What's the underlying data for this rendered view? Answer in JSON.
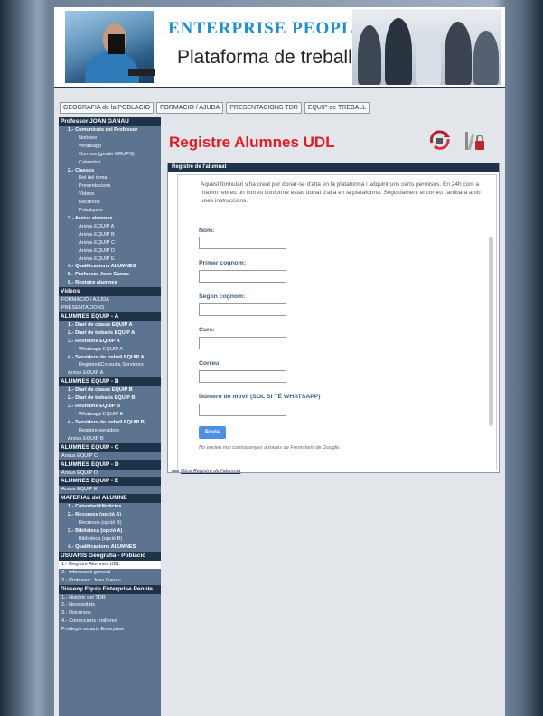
{
  "header": {
    "title": "ENTERPRISE  PEOPLE",
    "subtitle": "Plataforma de treball"
  },
  "tabs": [
    "GEOGRAFIA de la POBLACIÓ",
    "FORMACIÓ / AJUDA",
    "PRESENTACIONS TDR",
    "EQUIP de TREBALL"
  ],
  "sidebar": {
    "items": [
      {
        "text": "Professor JOAN GANAU",
        "kind": "head"
      },
      {
        "text": "1.- Comunicats del Professor",
        "kind": "l1"
      },
      {
        "text": "Notícies",
        "kind": "l2"
      },
      {
        "text": "Whatsapp",
        "kind": "l2"
      },
      {
        "text": "Correus (gestió GRUPS)",
        "kind": "l2"
      },
      {
        "text": "Calendari",
        "kind": "l2"
      },
      {
        "text": "2.- Classes",
        "kind": "l1"
      },
      {
        "text": "Rol del tema",
        "kind": "l2"
      },
      {
        "text": "Presentacions",
        "kind": "l2"
      },
      {
        "text": "Vídeos",
        "kind": "l2"
      },
      {
        "text": "Recursos",
        "kind": "l2"
      },
      {
        "text": "Pràctiques",
        "kind": "l2"
      },
      {
        "text": "3.- Arxius alumnes",
        "kind": "l1"
      },
      {
        "text": "Arxius EQUIP A",
        "kind": "l2"
      },
      {
        "text": "Arxius EQUIP B",
        "kind": "l2"
      },
      {
        "text": "Arxius EQUIP C",
        "kind": "l2"
      },
      {
        "text": "Arxius EQUIP D",
        "kind": "l2"
      },
      {
        "text": "Arxius EQUIP E",
        "kind": "l2"
      },
      {
        "text": "4.- Qualificacions ALUMNES",
        "kind": "l1"
      },
      {
        "text": "5.- Professor Joan Ganau",
        "kind": "l1"
      },
      {
        "text": "6.- Registre alumnes",
        "kind": "l1"
      },
      {
        "text": "Vídeos",
        "kind": "head"
      },
      {
        "text": "FORMACIÓ / AJUDA",
        "kind": "l0"
      },
      {
        "text": "PRESENTACIONS",
        "kind": "l0"
      },
      {
        "text": "ALUMNES EQUIP - A",
        "kind": "head"
      },
      {
        "text": "1.- Diari de classe EQUIP A",
        "kind": "l1"
      },
      {
        "text": "2.- Diari de treballs EQUIP A",
        "kind": "l1"
      },
      {
        "text": "3.- Reunions EQUIP A",
        "kind": "l1"
      },
      {
        "text": "Whatsapp EQUIP A",
        "kind": "l2"
      },
      {
        "text": "4.- Servidors de treball EQUIP A",
        "kind": "l1"
      },
      {
        "text": "Registre&Consulta Servidors",
        "kind": "l2"
      },
      {
        "text": "Arxius EQUIP A",
        "kind": "l0b"
      },
      {
        "text": "ALUMNES EQUIP - B",
        "kind": "head"
      },
      {
        "text": "1.- Diari de classe EQUIP B",
        "kind": "l1"
      },
      {
        "text": "2.- Diari de treballs EQUIP B",
        "kind": "l1"
      },
      {
        "text": "3.- Reunions EQUIP B",
        "kind": "l1"
      },
      {
        "text": "Whatsapp EQUIP B",
        "kind": "l2"
      },
      {
        "text": "4.- Servidors de treball EQUIP B",
        "kind": "l1"
      },
      {
        "text": "Registre servidors",
        "kind": "l2"
      },
      {
        "text": "Arxius EQUIP B",
        "kind": "l0b"
      },
      {
        "text": "ALUMNES EQUIP - C",
        "kind": "head"
      },
      {
        "text": "Arxius EQUIP C",
        "kind": "l0"
      },
      {
        "text": "ALUMNES EQUIP - D",
        "kind": "head"
      },
      {
        "text": "Arxius EQUIP D",
        "kind": "l0"
      },
      {
        "text": "ALUMNES EQUIP - E",
        "kind": "head"
      },
      {
        "text": "Arxius EQUIP E",
        "kind": "l0"
      },
      {
        "text": "MATERIAL del ALUMNE",
        "kind": "head"
      },
      {
        "text": "1.- Calendari&Notícies",
        "kind": "l1"
      },
      {
        "text": "2.- Recursos (opció A)",
        "kind": "l1"
      },
      {
        "text": "Recursos (opció B)",
        "kind": "l2"
      },
      {
        "text": "3.- Biblioteca (opció A)",
        "kind": "l1"
      },
      {
        "text": "Biblioteca (opció B)",
        "kind": "l2"
      },
      {
        "text": "4.- Qualificacions ALUMNES",
        "kind": "l1"
      },
      {
        "text": "USUARIS Geografia - Població",
        "kind": "head"
      },
      {
        "text": "1.- Registre Alumnes UDL",
        "kind": "active"
      },
      {
        "text": "2.- Informació general",
        "kind": "l0"
      },
      {
        "text": "3.- Professor: Joan Ganau",
        "kind": "l0"
      },
      {
        "text": "Disseny Equip Enterprise People",
        "kind": "head"
      },
      {
        "text": "1.- Històric del TDR",
        "kind": "l0"
      },
      {
        "text": "2.- Necessitats",
        "kind": "l0"
      },
      {
        "text": "3.- Discursos",
        "kind": "l0"
      },
      {
        "text": "4.- Correccions i millores",
        "kind": "l0"
      },
      {
        "text": "Privilegis usuaris Enterprise",
        "kind": "l0"
      }
    ]
  },
  "main": {
    "title": "Registre Alumnes UDL",
    "form_bar": "Registre de l'alumnat",
    "description": "Aquest formulari s'ha creat per donar-se d'alta en la plataforma i adquirir uns certs permisos. En 24h com a màxim rebreu un correu conforme estàs donat d'alta en la plataforma. Seguidament el correu t'arribarà amb unes instruccions.",
    "fields": [
      {
        "label": "Nom:",
        "value": ""
      },
      {
        "label": "Primer cognom:",
        "value": ""
      },
      {
        "label": "Segon cognom:",
        "value": ""
      },
      {
        "label": "Curs:",
        "value": ""
      },
      {
        "label": "Correu:",
        "value": ""
      },
      {
        "label": "Número de mòvil (SOL SI TÉ WHATSAPP)",
        "value": ""
      }
    ],
    "send_label": "Envia",
    "note": "No envieu mai contrasenyes a través de Formularis de Google.",
    "bottom_link": "Obre Registre de l'alumnat"
  }
}
